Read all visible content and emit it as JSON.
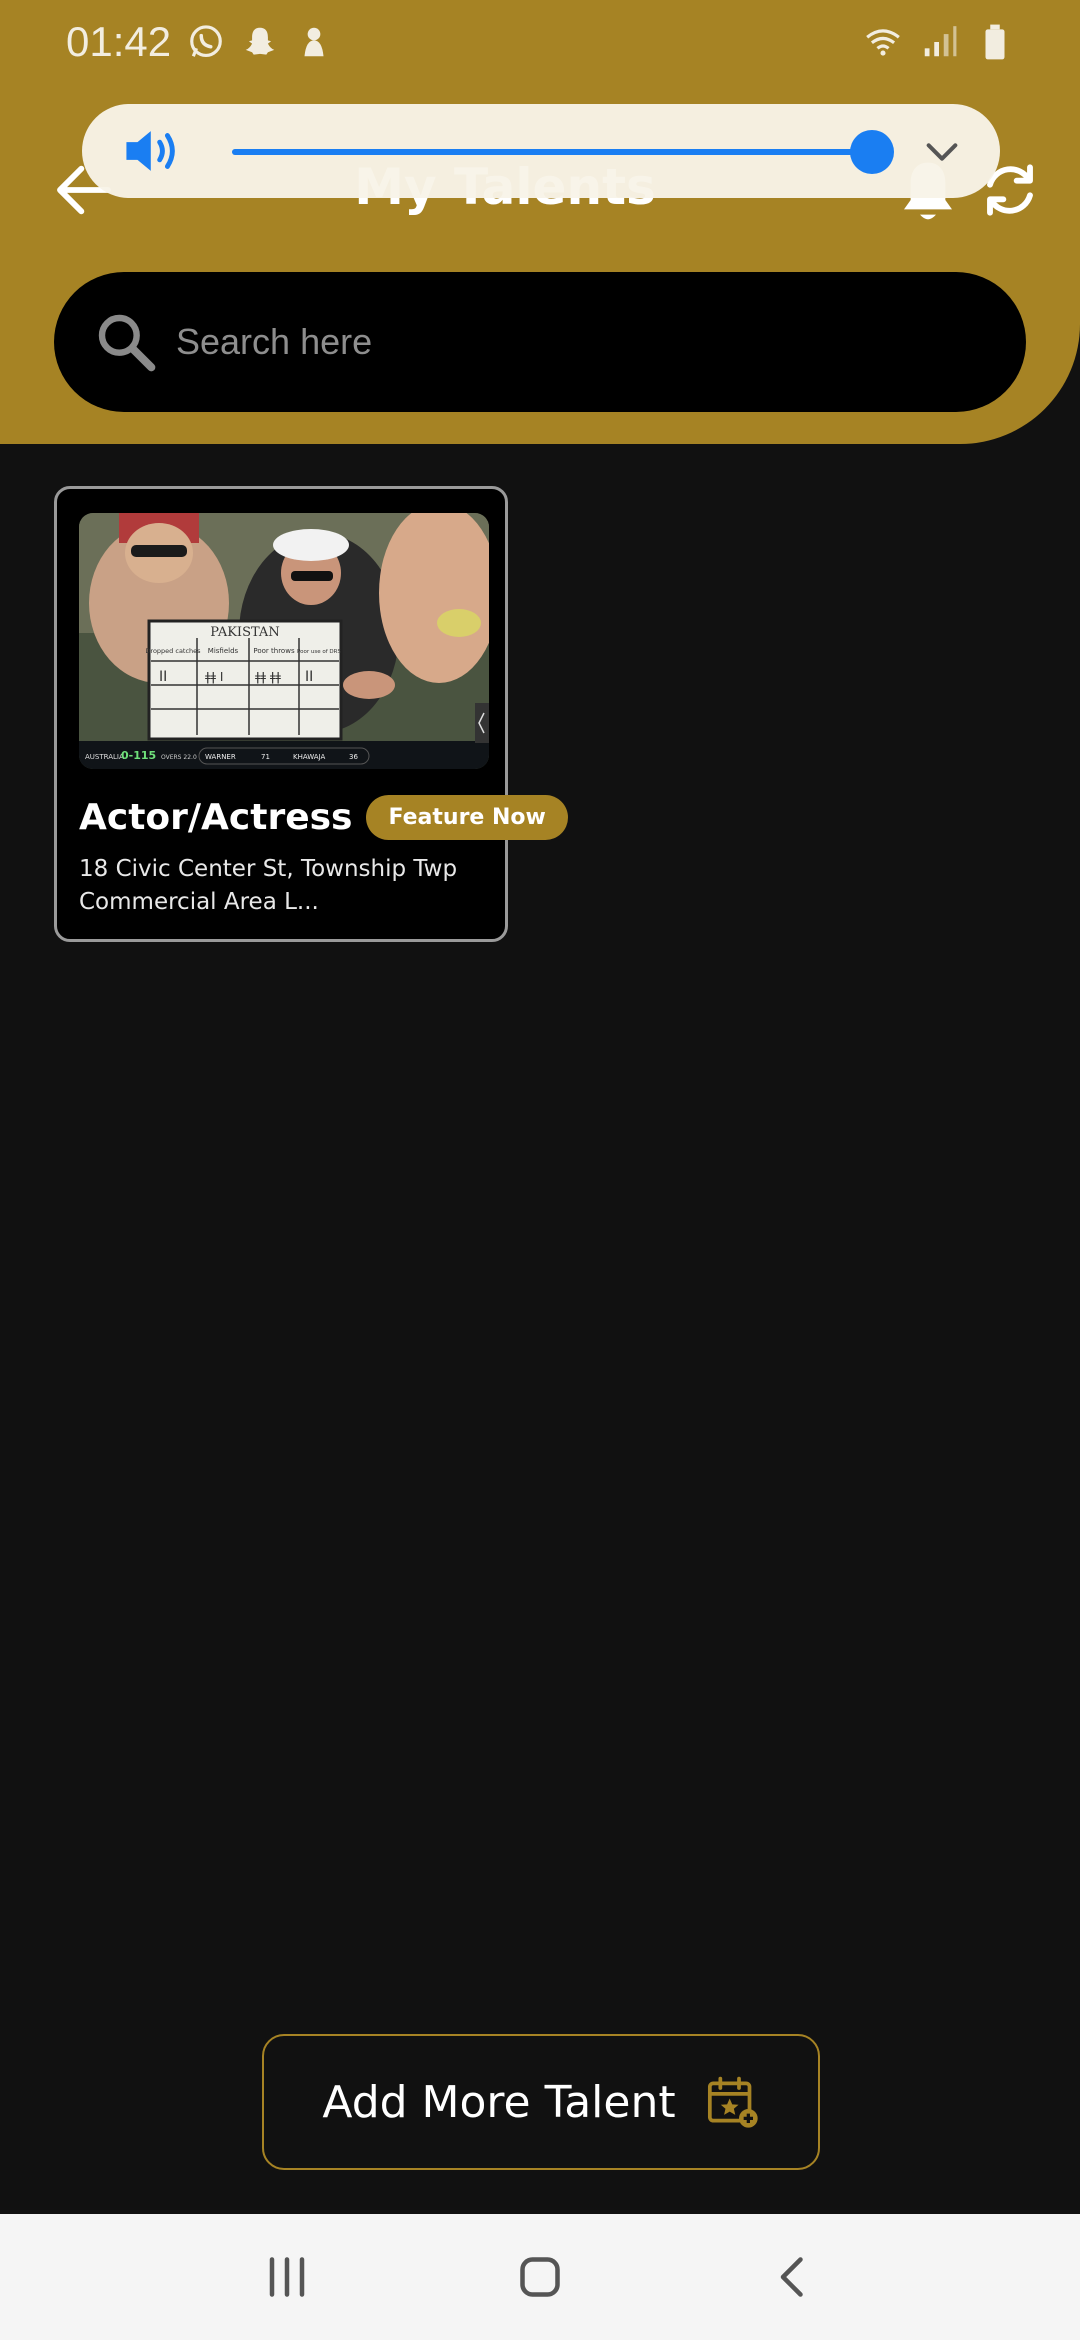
{
  "status_bar": {
    "time": "01:42",
    "left_icons": [
      "whatsapp-icon",
      "snapchat-icon",
      "ghost-icon"
    ],
    "right_icons": [
      "wifi-icon",
      "signal-icon",
      "battery-icon"
    ]
  },
  "header": {
    "title": "My Talents",
    "back_icon": "arrow-left-icon",
    "notification_icon": "bell-icon",
    "refresh_icon": "refresh-icon"
  },
  "volume_overlay": {
    "icon": "speaker-icon",
    "level_percent": 100,
    "expand_icon": "chevron-down-icon",
    "accent_color": "#1A7EF2"
  },
  "search": {
    "placeholder": "Search here"
  },
  "talents": [
    {
      "title": "Actor/Actress",
      "badge": "Feature Now",
      "address": "18 Civic Center St, Township Twp Commercial Area L...",
      "thumbnail": {
        "board_title": "PAKISTAN",
        "board_columns": [
          "Dropped catches",
          "Misfields",
          "Poor throws",
          "Poor use of DRS"
        ],
        "score_team": "AUSTRALIA",
        "score": "0-115",
        "overs": "OVERS 22.0",
        "batter_1": "WARNER",
        "batter_1_runs": "71",
        "batter_2": "KHAWAJA",
        "batter_2_runs": "36"
      }
    }
  ],
  "actions": {
    "add_talent_label": "Add More Talent",
    "add_talent_icon": "calendar-star-icon"
  },
  "nav_bar": {
    "buttons": [
      "recent-apps-icon",
      "home-icon",
      "back-icon"
    ]
  },
  "colors": {
    "brand_gold": "#A68324",
    "background": "#111111"
  }
}
